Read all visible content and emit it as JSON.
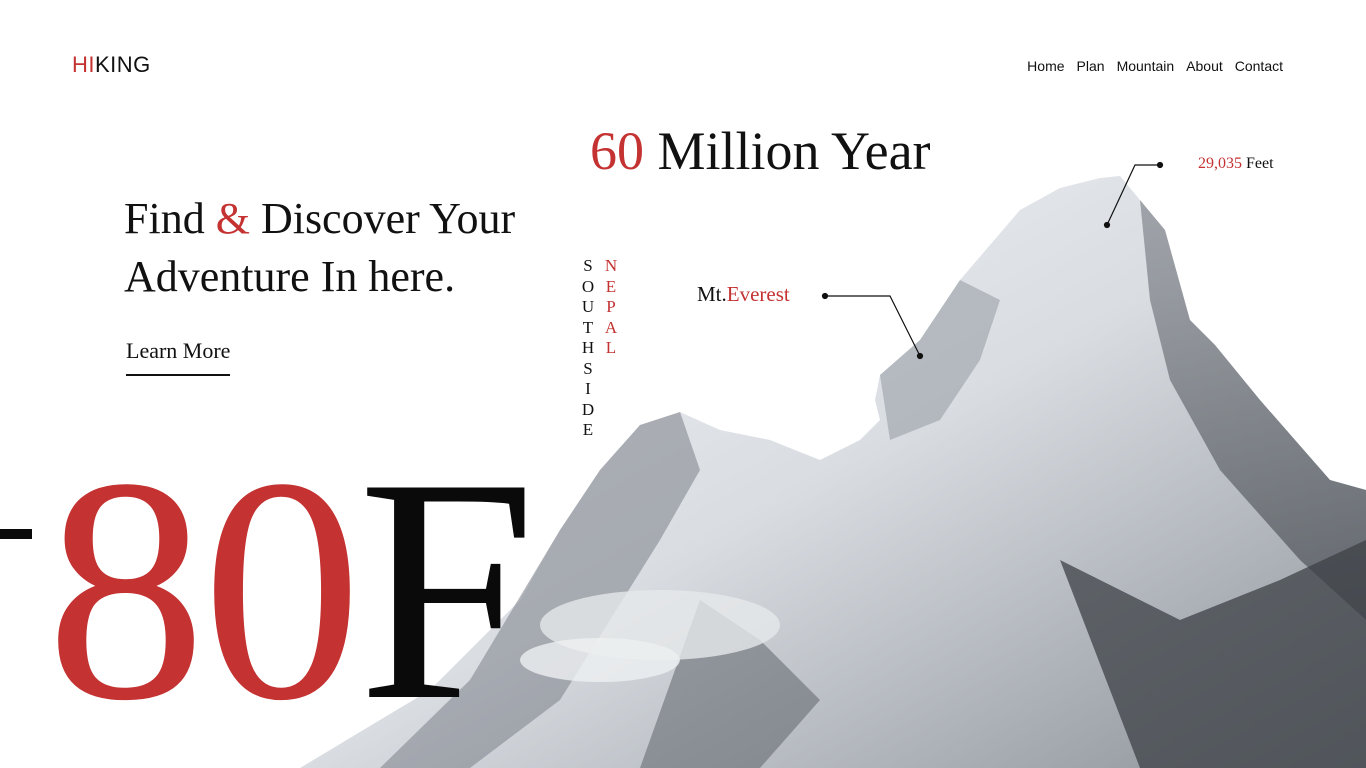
{
  "brand": {
    "part1": "HI",
    "part2": "KING",
    "accent": "#c43232"
  },
  "nav": [
    "Home",
    "Plan",
    "Mountain",
    "About",
    "Contact"
  ],
  "hero": {
    "line1_a": "Find",
    "line1_amp": "&",
    "line1_b": "Discover Your",
    "line2": "Adventure In here.",
    "cta": "Learn More"
  },
  "stat": {
    "number": "60",
    "label": "Million Year"
  },
  "vertical": {
    "left": "SOUTHSIDE",
    "right": "NEPAL"
  },
  "annotations": {
    "height_value": "29,035",
    "height_unit": "Feet",
    "peak_prefix": "Mt.",
    "peak_name": "Everest"
  },
  "temperature": {
    "sign": "-",
    "value": "80",
    "unit": "F"
  },
  "colors": {
    "accent": "#c43232",
    "text": "#111111",
    "background": "#ffffff"
  }
}
